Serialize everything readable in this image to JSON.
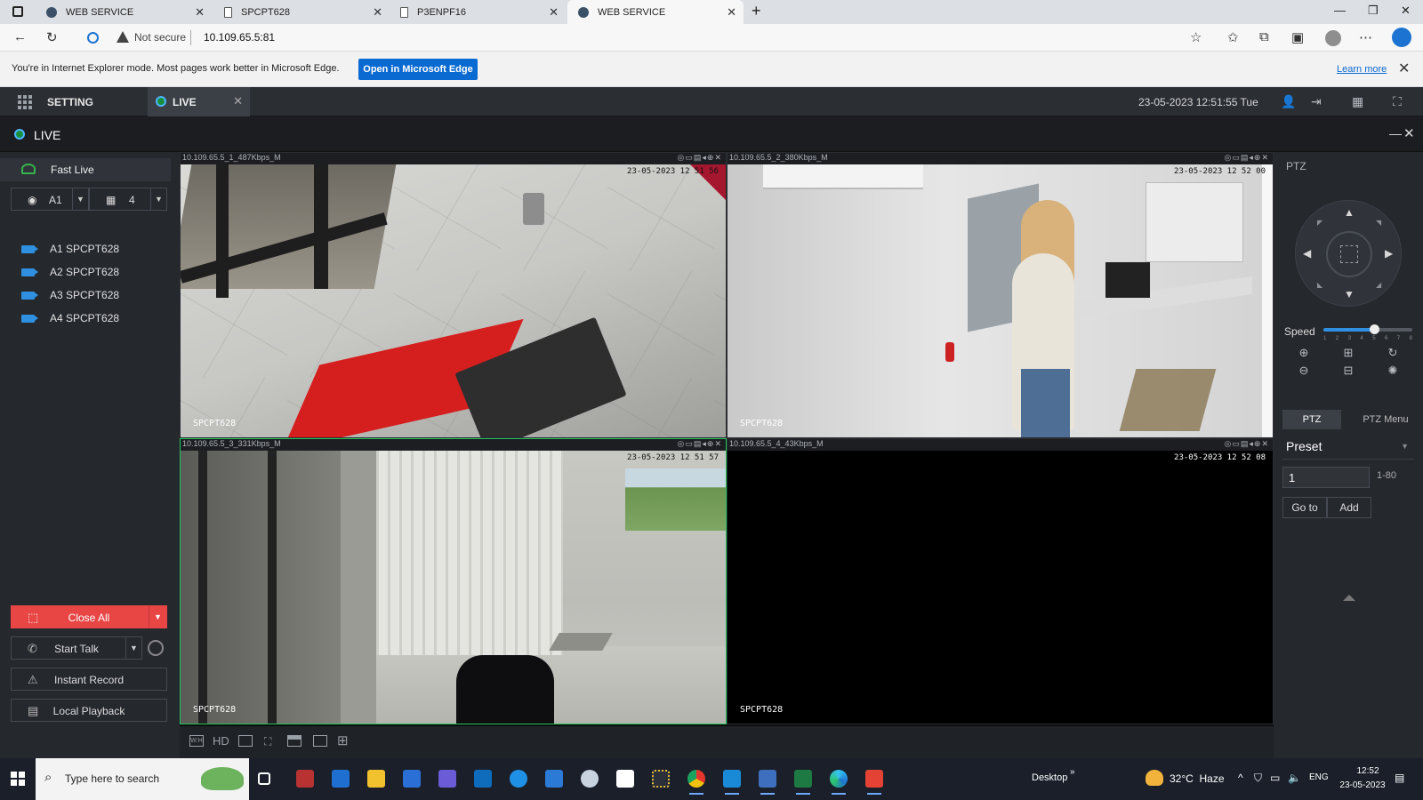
{
  "browser": {
    "tabs": [
      {
        "title": "WEB SERVICE",
        "active": false
      },
      {
        "title": "SPCPT628",
        "active": false
      },
      {
        "title": "P3ENPF16",
        "active": false
      },
      {
        "title": "WEB SERVICE",
        "active": true
      }
    ],
    "not_secure": "Not secure",
    "url": "10.109.65.5:81"
  },
  "ie_bar": {
    "message": "You're in Internet Explorer mode. Most pages work better in Microsoft Edge.",
    "button": "Open in Microsoft Edge",
    "learn_more": "Learn more"
  },
  "app_header": {
    "setting": "SETTING",
    "live_tab": "LIVE",
    "datetime": "23-05-2023 12:51:55 Tue"
  },
  "live_bar": {
    "title": "LIVE"
  },
  "left_panel": {
    "fast_live": "Fast Live",
    "channel_select": "A1",
    "layout_select": "4",
    "cameras": [
      {
        "label": "A1 SPCPT628"
      },
      {
        "label": "A2 SPCPT628"
      },
      {
        "label": "A3 SPCPT628"
      },
      {
        "label": "A4 SPCPT628"
      }
    ],
    "close_all": "Close All",
    "start_talk": "Start Talk",
    "instant_record": "Instant Record",
    "local_playback": "Local Playback"
  },
  "videos": [
    {
      "info": "10.109.65.5_1_487Kbps_M",
      "timestamp": "23-05-2023 12 51 56",
      "name": "SPCPT628"
    },
    {
      "info": "10.109.65.5_2_380Kbps_M",
      "timestamp": "23-05-2023 12 52 00",
      "name": "SPCPT628"
    },
    {
      "info": "10.109.65.5_3_331Kbps_M",
      "timestamp": "23-05-2023 12 51 57",
      "name": "SPCPT628"
    },
    {
      "info": "10.109.65.5_4_43Kbps_M",
      "timestamp": "23-05-2023 12 52 08",
      "name": "SPCPT628"
    }
  ],
  "ptz": {
    "title": "PTZ",
    "speed_label": "Speed",
    "speed_value": 5,
    "speed_max": 8,
    "speed_ticks": [
      "1",
      "2",
      "3",
      "4",
      "5",
      "6",
      "7",
      "8"
    ],
    "tab_ptz": "PTZ",
    "tab_menu": "PTZ Menu",
    "preset_select": "Preset",
    "preset_number": "1",
    "preset_range": "1-80",
    "goto": "Go to",
    "add": "Add"
  },
  "bottom_toolbar": {
    "hd": "HD"
  },
  "taskbar": {
    "search_placeholder": "Type here to search",
    "desktop": "Desktop",
    "temperature": "32°C",
    "weather": "Haze",
    "lang": "ENG",
    "time": "12:52",
    "date": "23-05-2023"
  }
}
